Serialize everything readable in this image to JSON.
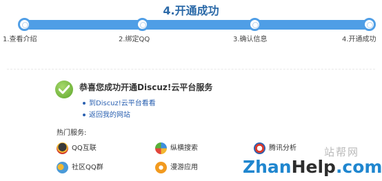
{
  "header": {
    "title": "4.开通成功"
  },
  "steps": [
    {
      "label": "1.查看介绍"
    },
    {
      "label": "2.绑定QQ"
    },
    {
      "label": "3.确认信息"
    },
    {
      "label": "4.开通成功"
    }
  ],
  "success": {
    "message": "恭喜您成功开通Discuz!云平台服务",
    "links": [
      {
        "label": "到Discuz!云平台看看"
      },
      {
        "label": "返回我的网站"
      }
    ]
  },
  "hot_services": {
    "title": "热门服务:",
    "items": [
      {
        "label": "QQ互联",
        "icon": "qq-penguin-icon"
      },
      {
        "label": "纵横搜索",
        "icon": "search-s-icon"
      },
      {
        "label": "腾讯分析",
        "icon": "analytics-icon"
      },
      {
        "label": "社区QQ群",
        "icon": "qq-group-icon"
      },
      {
        "label": "漫游应用",
        "icon": "manyou-icon"
      }
    ]
  },
  "watermark": {
    "site_name": "站帮网",
    "brand_part1": "Zhan",
    "brand_part2": "Help",
    "brand_part3": ".com"
  },
  "colors": {
    "accent": "#4f9ee6",
    "title": "#2c6aa8",
    "link": "#2b61b1",
    "success_green": "#5ea62c"
  }
}
